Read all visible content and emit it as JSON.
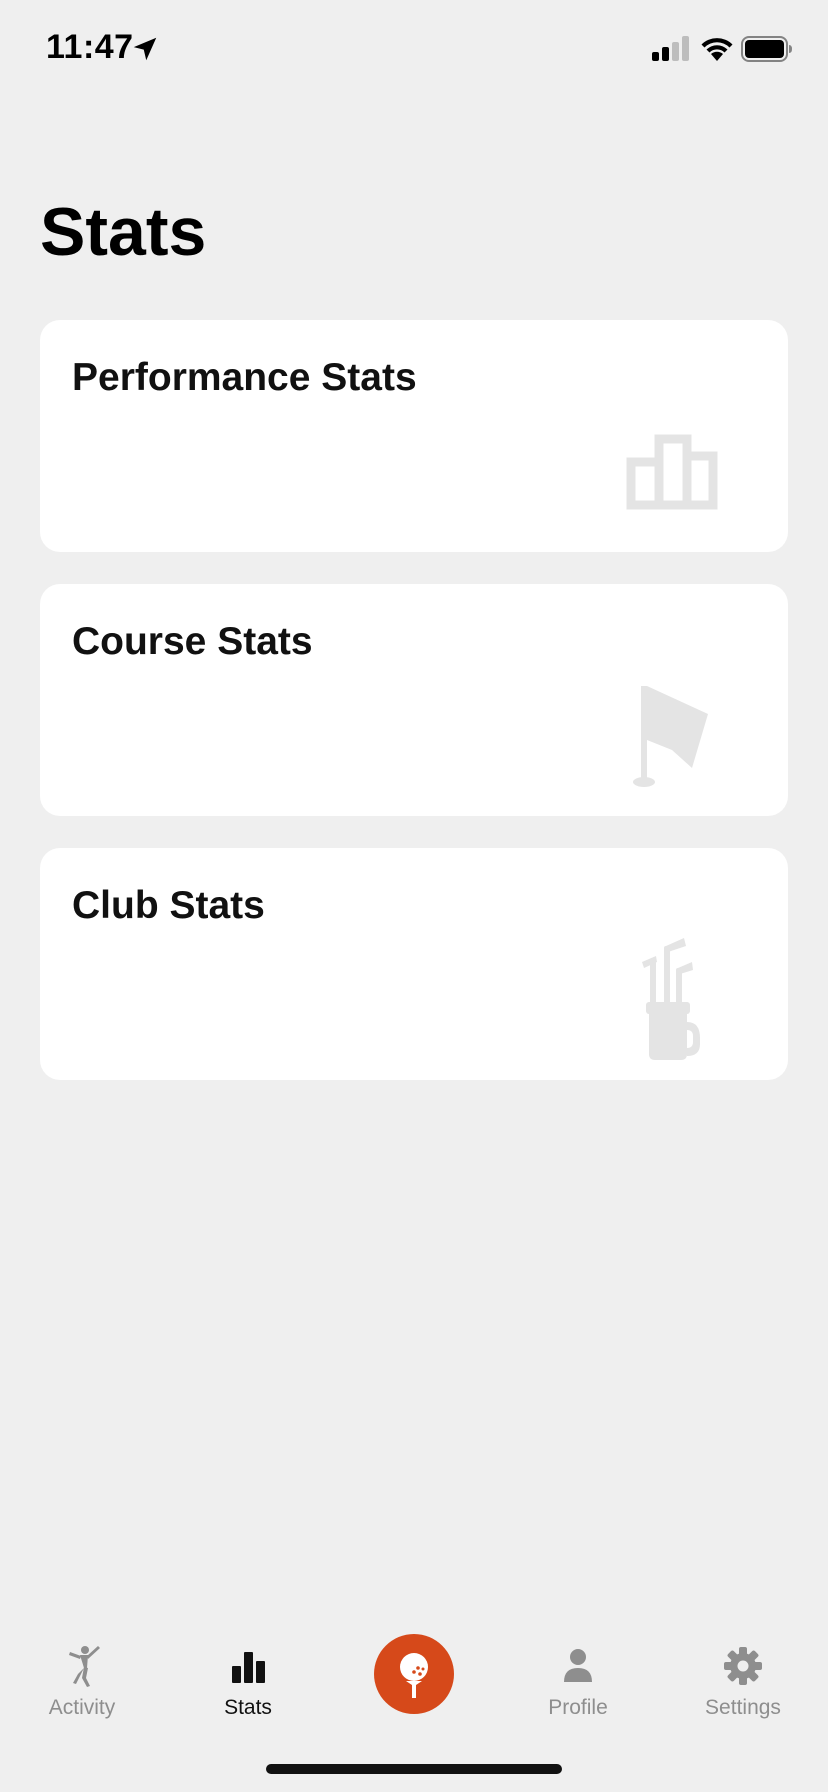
{
  "status_bar": {
    "time": "11:47",
    "icons": [
      "location-arrow-icon",
      "cellular-signal-icon",
      "wifi-icon",
      "battery-icon"
    ]
  },
  "page": {
    "title": "Stats"
  },
  "cards": [
    {
      "title": "Performance Stats",
      "icon": "podium-icon"
    },
    {
      "title": "Course Stats",
      "icon": "flag-icon"
    },
    {
      "title": "Club Stats",
      "icon": "golf-bag-icon"
    }
  ],
  "tab_bar": {
    "tabs": [
      {
        "label": "Activity",
        "icon": "golfer-icon",
        "active": false
      },
      {
        "label": "Stats",
        "icon": "bar-chart-icon",
        "active": true
      },
      {
        "label": "",
        "icon": "golf-ball-tee-icon",
        "active": false
      },
      {
        "label": "Profile",
        "icon": "person-icon",
        "active": false
      },
      {
        "label": "Settings",
        "icon": "gear-icon",
        "active": false
      }
    ]
  },
  "colors": {
    "background": "#efefef",
    "card": "#ffffff",
    "accent": "#d6491a",
    "card_icon": "#e4e4e4",
    "tab_inactive": "#8e8e8e",
    "tab_active": "#111111"
  }
}
